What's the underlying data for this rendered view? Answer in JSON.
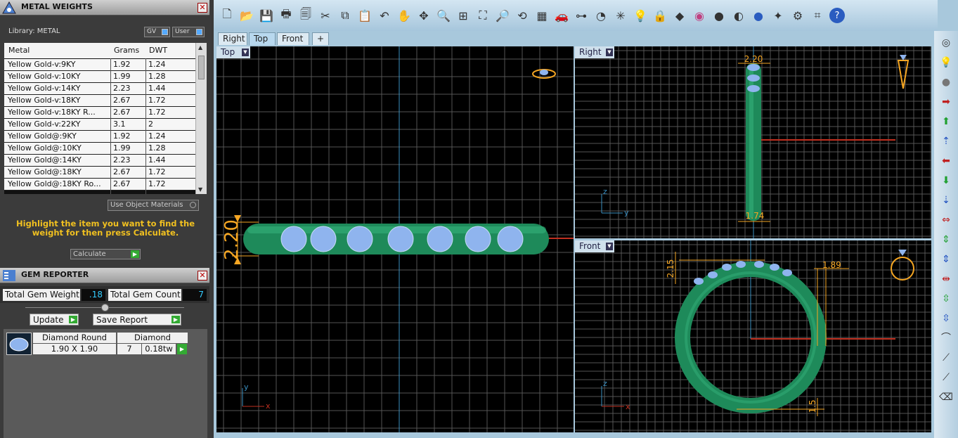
{
  "metal_panel": {
    "title": "METAL WEIGHTS",
    "library": "Library: METAL",
    "gv": "GV",
    "user": "User",
    "columns": [
      "Metal",
      "Grams",
      "DWT"
    ],
    "rows": [
      [
        "Yellow Gold-v:9KY",
        "1.92",
        "1.24"
      ],
      [
        "Yellow Gold-v:10KY",
        "1.99",
        "1.28"
      ],
      [
        "Yellow Gold-v:14KY",
        "2.23",
        "1.44"
      ],
      [
        "Yellow Gold-v:18KY",
        "2.67",
        "1.72"
      ],
      [
        "Yellow Gold-v:18KY R...",
        "2.67",
        "1.72"
      ],
      [
        "Yellow Gold-v:22KY",
        "3.1",
        "2"
      ],
      [
        "Yellow Gold@:9KY",
        "1.92",
        "1.24"
      ],
      [
        "Yellow Gold@:10KY",
        "1.99",
        "1.28"
      ],
      [
        "Yellow Gold@:14KY",
        "2.23",
        "1.44"
      ],
      [
        "Yellow Gold@:18KY",
        "2.67",
        "1.72"
      ],
      [
        "Yellow Gold@:18KY Ro...",
        "2.67",
        "1.72"
      ]
    ],
    "use_object_materials": "Use Object Materials",
    "hint": "Highlight the item you want to find the weight for then press Calculate.",
    "calculate": "Calculate"
  },
  "gem_panel": {
    "title": "GEM REPORTER",
    "total_weight_label": "Total Gem Weight",
    "total_weight": ".18",
    "total_count_label": "Total Gem Count",
    "total_count": "7",
    "update": "Update",
    "save_report": "Save Report",
    "gem": {
      "shape": "Diamond Round",
      "material": "Diamond",
      "size": "1.90 X 1.90",
      "count": "7",
      "tw": "0.18tw"
    }
  },
  "tabs": [
    "Right",
    "Top",
    "Front",
    "+"
  ],
  "viewports": {
    "top": {
      "label": "Top",
      "dim": "2.20",
      "axis_v": "y",
      "axis_h": "x"
    },
    "right": {
      "label": "Right",
      "dim_top": "2.20",
      "dim_bottom": "1.74",
      "axis_v": "z",
      "axis_h": "y"
    },
    "front": {
      "label": "Front",
      "dim_left": "2.15",
      "dim_right": "1.89",
      "dim_bottom": "1.5",
      "axis_v": "z",
      "axis_h": "x"
    }
  },
  "colors": {
    "ring": "#1e8a5a",
    "stone": "#8fb4ee",
    "dim": "#f5a623",
    "grid": "#5a5a5a",
    "axis_blue": "#3a8fc0",
    "axis_red": "#c03020"
  }
}
